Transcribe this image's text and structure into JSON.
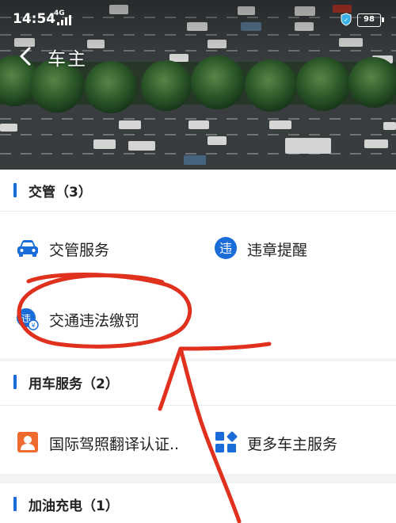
{
  "status_bar": {
    "time": "14:54",
    "network": "4G",
    "battery": "98"
  },
  "header": {
    "title": "车主"
  },
  "sections": [
    {
      "title": "交管（3）",
      "items": [
        {
          "label": "交管服务",
          "icon": "car-icon"
        },
        {
          "label": "违章提醒",
          "icon": "violation-badge-icon"
        },
        {
          "label": "交通违法缴罚",
          "icon": "fine-payment-icon"
        }
      ]
    },
    {
      "title": "用车服务（2）",
      "items": [
        {
          "label": "国际驾照翻译认证..",
          "icon": "id-card-icon"
        },
        {
          "label": "更多车主服务",
          "icon": "grid-apps-icon"
        }
      ]
    },
    {
      "title": "加油充电（1）",
      "items": []
    }
  ],
  "colors": {
    "accent_blue": "#1a6dd8",
    "id_card_orange": "#ee6a2e",
    "annotation_red": "#e0301e"
  }
}
